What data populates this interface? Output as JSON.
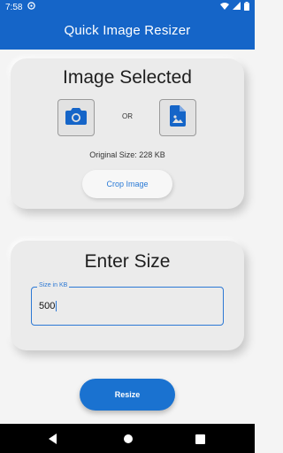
{
  "status": {
    "time": "7:58",
    "icons": [
      "notification-icon",
      "wifi-icon",
      "signal-icon",
      "battery-icon"
    ]
  },
  "appbar": {
    "title": "Quick Image Resizer",
    "color": "#1565c8"
  },
  "image_card": {
    "title": "Image Selected",
    "camera_icon": "camera-icon",
    "or_label": "OR",
    "file_icon": "image-file-icon",
    "original_size": "Original Size: 228 KB",
    "crop_label": "Crop Image"
  },
  "size_card": {
    "title": "Enter Size",
    "field_label": "Size in KB",
    "field_value": "500"
  },
  "actions": {
    "resize_label": "Resize"
  },
  "navbar": {
    "icons": [
      "back-icon",
      "home-icon",
      "recents-icon"
    ]
  }
}
